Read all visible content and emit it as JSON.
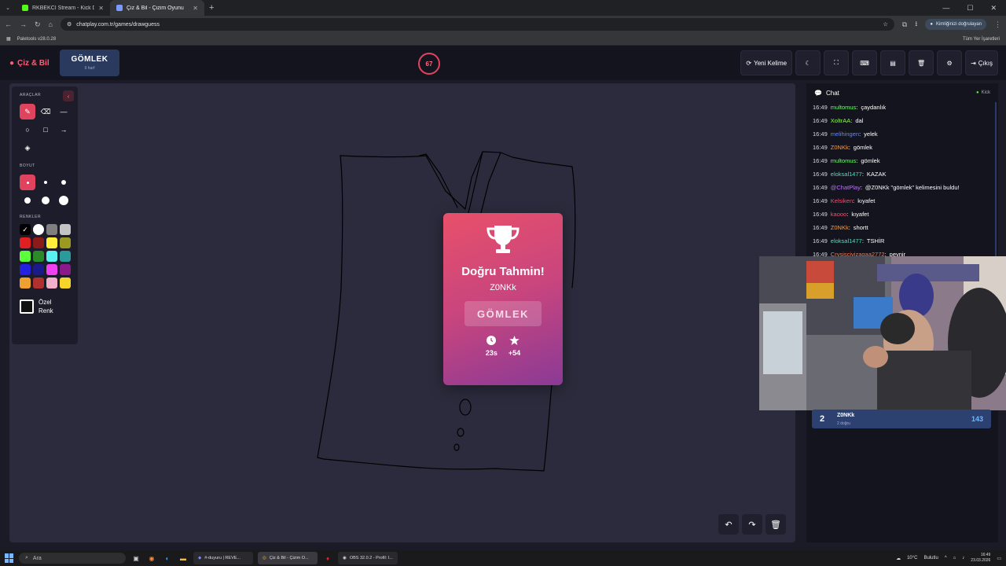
{
  "browser": {
    "tabs": [
      {
        "title": "RKBEKCI Stream - Kick Dashbo",
        "active": false,
        "color": "#53fc18"
      },
      {
        "title": "Çiz & Bil - Çizim Oyunu",
        "active": true,
        "color": "#7a9aff"
      }
    ],
    "url": "chatplay.com.tr/games/drawguess",
    "profile_label": "Kimliğinizi doğrulayan",
    "bookmark": "Paletools v28.0.28",
    "all_bookmarks": "Tüm Yer İşaretleri"
  },
  "header": {
    "brand": "Çiz & Bil",
    "word": "GÖMLEK",
    "word_sub": "6 harf",
    "timer": "67",
    "new_word": "Yeni Kelime",
    "exit": "Çıkış"
  },
  "tools": {
    "tools_label": "ARAÇLAR",
    "size_label": "BOYUT",
    "colors_label": "RENKLER",
    "custom_label": "Özel Renk",
    "colors": [
      "#000000",
      "#ffffff",
      "#7f7f7f",
      "#c3c3c3",
      "#e02020",
      "#8b1a1a",
      "#ffef3b",
      "#9a9a22",
      "#5bff3b",
      "#2a8a2a",
      "#5af1f1",
      "#2a9a9a",
      "#2222e0",
      "#1a1a8a",
      "#f040f0",
      "#8a1a8a",
      "#f0a030",
      "#b03030",
      "#f3b0c8",
      "#f5d52a"
    ]
  },
  "modal": {
    "title": "Doğru Tahmin!",
    "user": "Z0NKk",
    "word": "GÖMLEK",
    "time": "23s",
    "points": "+54"
  },
  "chat": {
    "title": "Chat",
    "platform": "Kick",
    "messages": [
      {
        "time": "16:49",
        "user": "multomus",
        "text": "çaydanlık",
        "color": "#6bff6b"
      },
      {
        "time": "16:49",
        "user": "XoltrAA",
        "text": "dal",
        "color": "#8aff4a"
      },
      {
        "time": "16:49",
        "user": "melihingen",
        "text": "yelek",
        "color": "#5a8aff"
      },
      {
        "time": "16:49",
        "user": "Z0NKk",
        "text": "gömlek",
        "color": "#ff9a3a"
      },
      {
        "time": "16:49",
        "user": "multomus",
        "text": "gömlek",
        "color": "#6bff6b"
      },
      {
        "time": "16:49",
        "user": "eloksal1477",
        "text": "KAZAK",
        "color": "#4ae0c0"
      },
      {
        "time": "16:49",
        "user": "@ChatPlay",
        "text": "@Z0NKk \"gömlek\" kelimesini buldu!",
        "color": "#c070ff"
      },
      {
        "time": "16:49",
        "user": "Kelsiken",
        "text": "kıyafet",
        "color": "#ff4a6a"
      },
      {
        "time": "16:49",
        "user": "kaooo",
        "text": "kıyafet",
        "color": "#ff4a6a"
      },
      {
        "time": "16:49",
        "user": "Z0NKk",
        "text": "shortt",
        "color": "#ff9a3a"
      },
      {
        "time": "16:49",
        "user": "eloksal1477",
        "text": "TSHİR",
        "color": "#4ae0c0"
      },
      {
        "time": "16:49",
        "user": "Crysiscivizagaa2772",
        "text": "peynir",
        "color": "#ff7a4a"
      }
    ]
  },
  "leaderboard": {
    "rank": "2",
    "name": "Z0NKk",
    "sub": "2 doğru",
    "score": "143"
  },
  "taskbar": {
    "search": "Ara",
    "apps": [
      "#-duyuru | REVE...",
      "Çiz & Bil - Çizim O...",
      "OBS 32.0.2 - Profil: I..."
    ],
    "weather": "10°C",
    "weather_desc": "Bulutlu",
    "time": "16:49",
    "date": "23.03.2026"
  }
}
